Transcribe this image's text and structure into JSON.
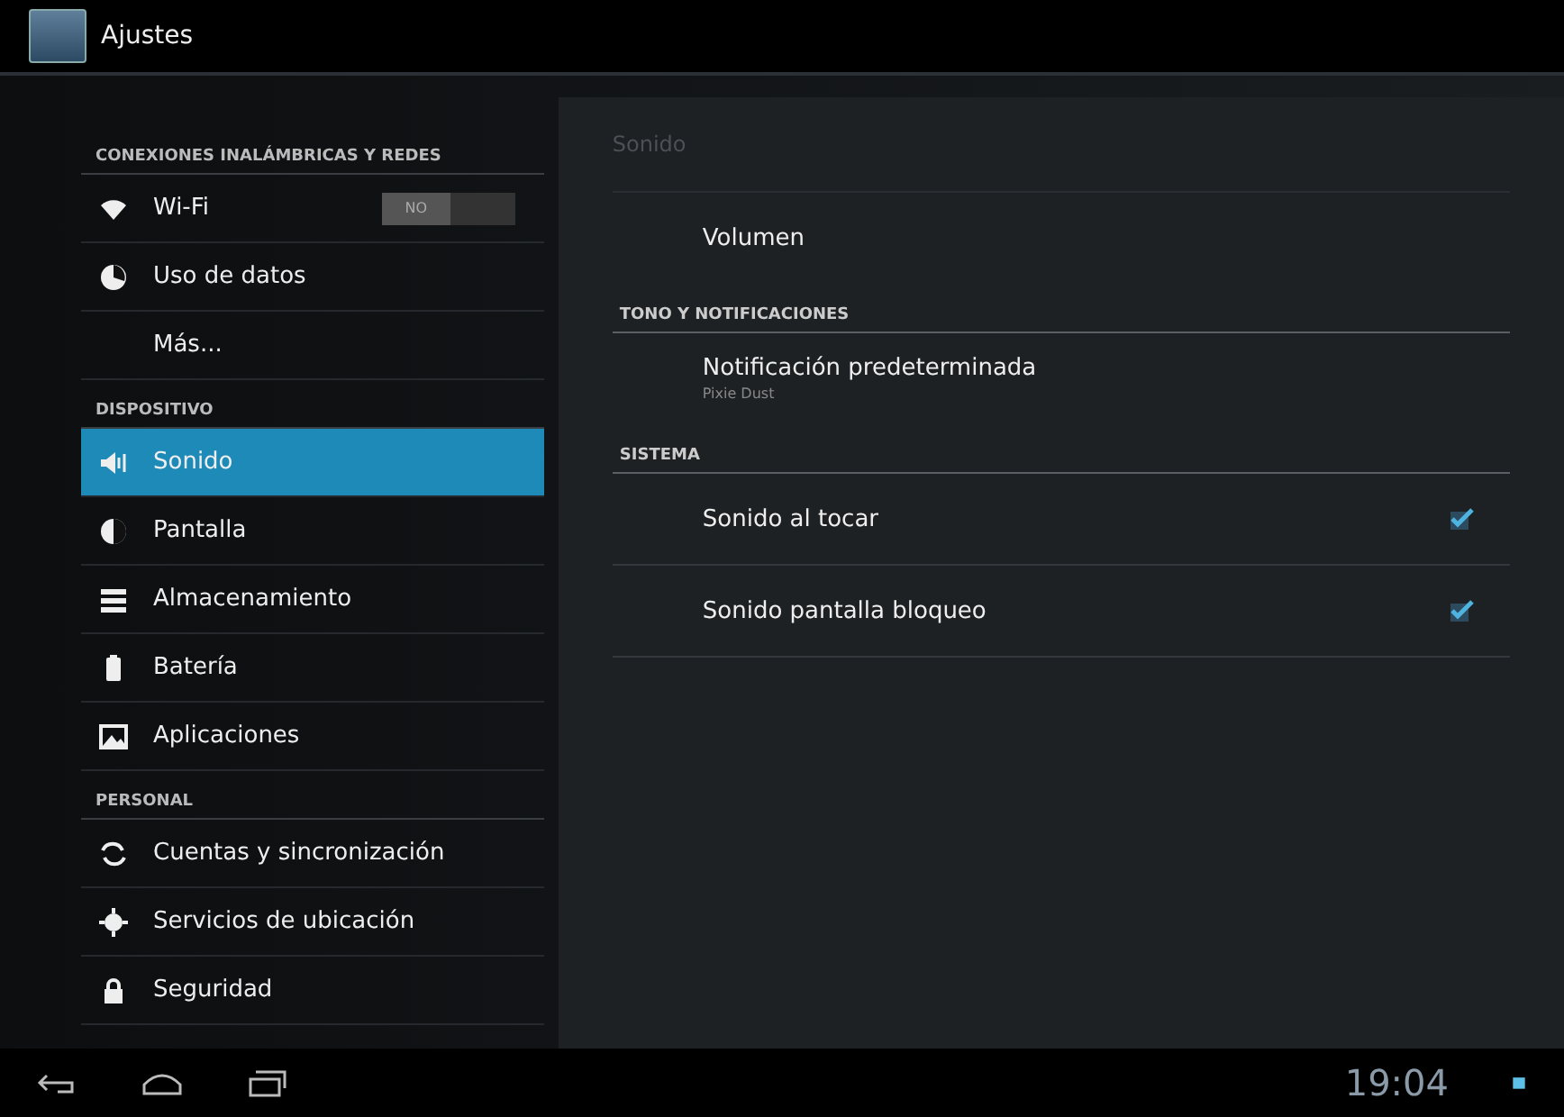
{
  "action_bar": {
    "title": "Ajustes"
  },
  "sidebar": {
    "items": [
      {
        "kind": "header",
        "label": "CONEXIONES INALÁMBRICAS Y REDES"
      },
      {
        "kind": "toggle",
        "label": "Wi-Fi",
        "toggle_label": "NO",
        "on": false,
        "selected": false
      },
      {
        "kind": "item",
        "label": "Uso de datos",
        "selected": false
      },
      {
        "kind": "item",
        "label": "Más...",
        "selected": false
      },
      {
        "kind": "header",
        "label": "DISPOSITIVO"
      },
      {
        "kind": "item",
        "label": "Sonido",
        "selected": true
      },
      {
        "kind": "item",
        "label": "Pantalla",
        "selected": false
      },
      {
        "kind": "item",
        "label": "Almacenamiento",
        "selected": false
      },
      {
        "kind": "item",
        "label": "Batería",
        "selected": false
      },
      {
        "kind": "item",
        "label": "Aplicaciones",
        "selected": false
      },
      {
        "kind": "header",
        "label": "PERSONAL"
      },
      {
        "kind": "item",
        "label": "Cuentas y sincronización",
        "selected": false
      },
      {
        "kind": "item",
        "label": "Servicios de ubicación",
        "selected": false
      },
      {
        "kind": "item",
        "label": "Seguridad",
        "selected": false
      }
    ]
  },
  "detail": {
    "title": "Sonido",
    "items": [
      {
        "kind": "item",
        "label": "Volumen"
      },
      {
        "kind": "header",
        "label": "TONO Y NOTIFICACIONES"
      },
      {
        "kind": "item",
        "label": "Notificación predeterminada",
        "summary": "Pixie Dust"
      },
      {
        "kind": "header",
        "label": "SISTEMA"
      },
      {
        "kind": "check",
        "label": "Sonido al tocar",
        "checked": true
      },
      {
        "kind": "check",
        "label": "Sonido pantalla bloqueo",
        "checked": true
      }
    ]
  },
  "status_bar": {
    "time": "19:04"
  }
}
